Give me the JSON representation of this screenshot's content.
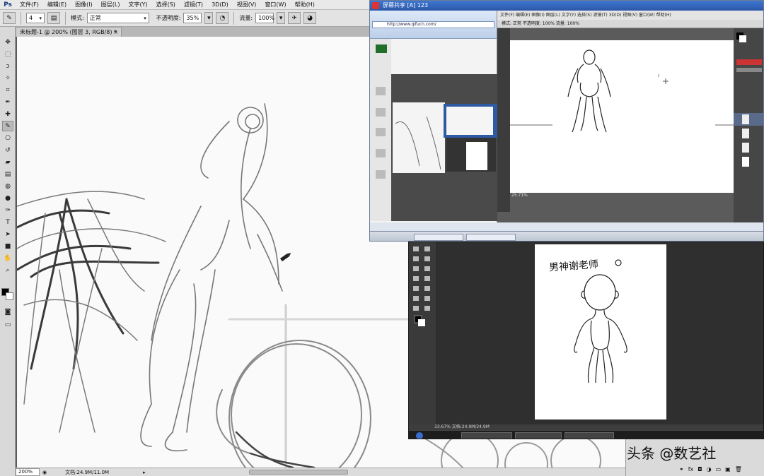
{
  "app": {
    "logo": "Ps",
    "menu": [
      "文件(F)",
      "编辑(E)",
      "图像(I)",
      "图层(L)",
      "文字(Y)",
      "选择(S)",
      "滤镜(T)",
      "3D(D)",
      "视图(V)",
      "窗口(W)",
      "帮助(H)"
    ]
  },
  "options": {
    "brush_size": "4",
    "mode_label": "模式:",
    "mode_value": "正常",
    "opacity_label": "不透明度:",
    "opacity_value": "35%",
    "flow_label": "流量:",
    "flow_value": "100%"
  },
  "document": {
    "tab_title": "未标题-1 @ 200% (图层 3, RGB/8) *",
    "tab_close": "×",
    "zoom": "200%",
    "doc_size": "文档:24.9M/11.0M"
  },
  "share_window": {
    "title": "屏幕共享 [A] 123",
    "ps_menu": "文件(F) 编辑(E) 图像(I) 图层(L) 文字(Y) 选择(S) 滤镜(T) 3D(D) 视图(V) 窗口(W) 帮助(H)",
    "ps_opts": "模式: 正常   不透明度: 100%   流量: 100%",
    "browser_url": "http://www.qifucn.com/",
    "ps_status": "25.71%",
    "taskbar_items": [
      "",
      ""
    ]
  },
  "dark_window": {
    "caption": "男神谢老师",
    "status": "33.67%   文档:24.9M/24.9M",
    "taskbar_items": [
      "",
      "",
      ""
    ]
  },
  "watermark": "头条 @数艺社",
  "colors": {
    "canvas": "#fafafa",
    "title_blue": "#2b58a8"
  }
}
